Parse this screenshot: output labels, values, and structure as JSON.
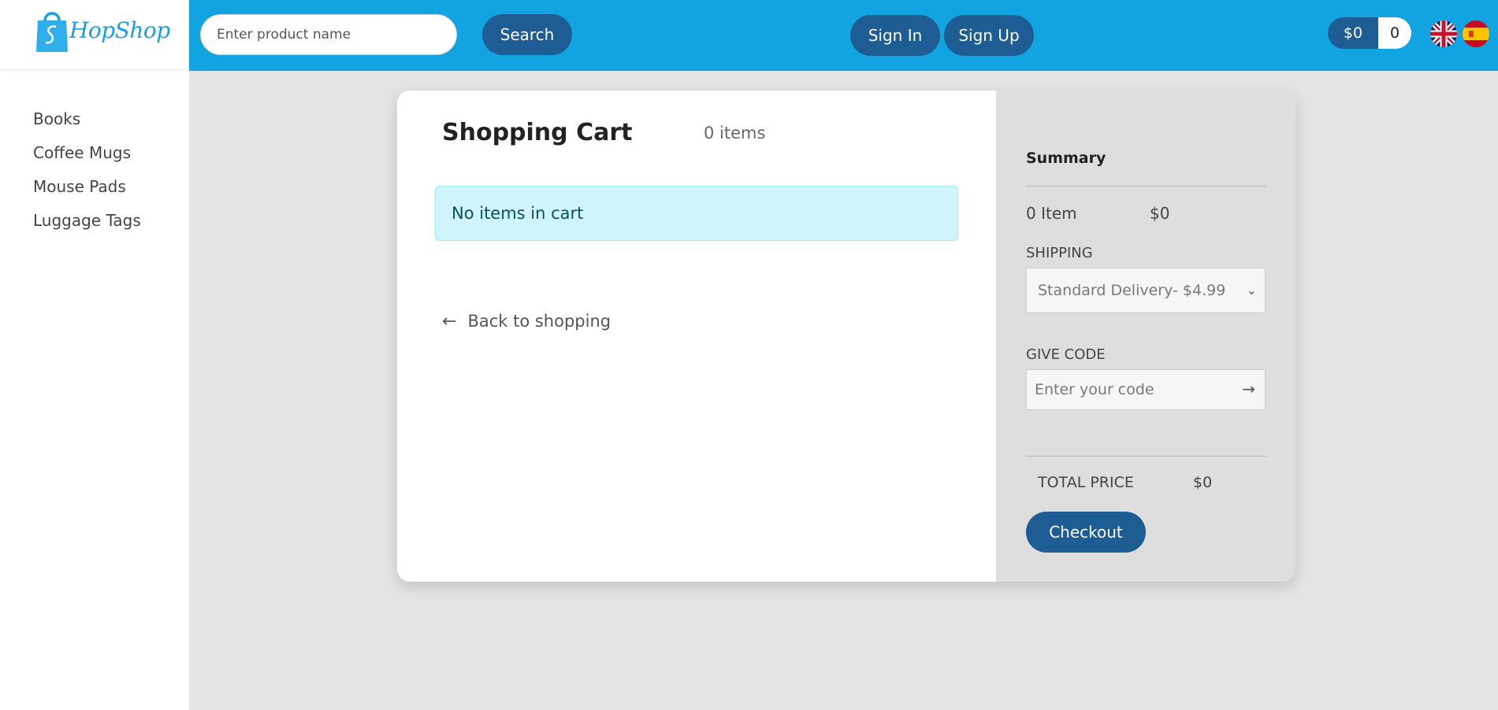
{
  "brand": {
    "name": "HopShop",
    "logo_icon": "shopping-bag-icon",
    "color": "#1aa0e0"
  },
  "sidebar": {
    "items": [
      {
        "label": "Books"
      },
      {
        "label": "Coffee Mugs"
      },
      {
        "label": "Mouse Pads"
      },
      {
        "label": "Luggage Tags"
      }
    ]
  },
  "header": {
    "background": "#12a3e1",
    "search": {
      "placeholder": "Enter product name",
      "value": "",
      "button_label": "Search"
    },
    "signin_label": "Sign In",
    "signup_label": "Sign Up",
    "cart": {
      "total": "$0",
      "count": "0"
    },
    "languages": [
      {
        "code": "en",
        "icon": "uk-flag-icon"
      },
      {
        "code": "es",
        "icon": "spain-flag-icon"
      }
    ]
  },
  "cart": {
    "title": "Shopping Cart",
    "items_count": "0 items",
    "empty_message": "No items in cart",
    "back_label": "Back to shopping"
  },
  "summary": {
    "title": "Summary",
    "items_label": "0 Item",
    "items_price": "$0",
    "shipping_label": "SHIPPING",
    "shipping_selected": "Standard Delivery- $4.99",
    "code_label": "GIVE CODE",
    "code_placeholder": "Enter your code",
    "total_label": "TOTAL PRICE",
    "total_value": "$0",
    "checkout_label": "Checkout"
  },
  "colors": {
    "primary_button": "#1e5c94",
    "alert_bg": "#cff4fc",
    "summary_bg": "#dedede"
  }
}
